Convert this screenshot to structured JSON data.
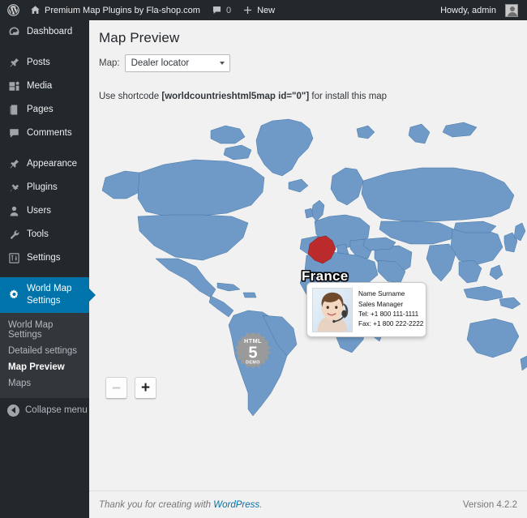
{
  "adminbar": {
    "wp_logo_icon": "wordpress-logo-icon",
    "site_home_icon": "home-icon",
    "site_name": "Premium Map Plugins by Fla-shop.com",
    "comments_icon": "comment-bubble-icon",
    "comments_count": "0",
    "new_icon": "plus-icon",
    "new_label": "New",
    "greeting": "Howdy, admin",
    "avatar_icon": "user-avatar-icon"
  },
  "sidebar": {
    "items": [
      {
        "label": "Dashboard",
        "icon": "dashboard-icon",
        "active": false
      },
      {
        "label": "Posts",
        "icon": "pin-icon",
        "active": false
      },
      {
        "label": "Media",
        "icon": "media-icon",
        "active": false
      },
      {
        "label": "Pages",
        "icon": "page-icon",
        "active": false
      },
      {
        "label": "Comments",
        "icon": "comment-bubble-icon",
        "active": false
      },
      {
        "label": "Appearance",
        "icon": "paintbrush-icon",
        "active": false
      },
      {
        "label": "Plugins",
        "icon": "plug-icon",
        "active": false
      },
      {
        "label": "Users",
        "icon": "user-icon",
        "active": false
      },
      {
        "label": "Tools",
        "icon": "wrench-icon",
        "active": false
      },
      {
        "label": "Settings",
        "icon": "sliders-icon",
        "active": false
      },
      {
        "label": "World Map Settings",
        "icon": "gear-icon",
        "active": true
      }
    ],
    "submenu": [
      {
        "label": "World Map Settings",
        "current": false
      },
      {
        "label": "Detailed settings",
        "current": false
      },
      {
        "label": "Map Preview",
        "current": true
      },
      {
        "label": "Maps",
        "current": false
      }
    ],
    "collapse": {
      "label": "Collapse menu",
      "icon": "collapse-arrow-icon"
    },
    "active_color": "#0073aa",
    "background_color": "#23282d",
    "submenu_background_color": "#32373c"
  },
  "main": {
    "page_title": "Map Preview",
    "map_select": {
      "label": "Map:",
      "value": "Dealer locator",
      "options": [
        "Dealer locator"
      ],
      "caret_icon": "chevron-down-icon"
    },
    "shortcode": {
      "prefix": "Use shortcode ",
      "code": "[worldcountrieshtml5map id=\"0\"]",
      "suffix": " for install this map"
    }
  },
  "map": {
    "selected_country": "France",
    "land_color": "#6f9ac7",
    "land_border_color": "#3c6ea0",
    "highlight_color": "#bb2b2b",
    "background_color": "#f1f1f1",
    "tooltip": {
      "photo_icon": "headset-agent-photo",
      "name": "Name Surname",
      "title": "Sales Manager",
      "tel": "Tel: +1 800 111-1111",
      "fax": "Fax: +1 800 222-2222"
    },
    "badge": {
      "top_text": "HTML",
      "number": "5",
      "bottom_text": "DEMO",
      "color": "#999999"
    },
    "zoom_controls": {
      "zoom_out_label": "–",
      "zoom_out_icon": "minus-icon",
      "zoom_out_disabled": true,
      "zoom_in_label": "+",
      "zoom_in_icon": "plus-icon",
      "zoom_in_disabled": false
    }
  },
  "footer": {
    "thanks_prefix": "Thank you for creating with ",
    "wordpress_link": "WordPress",
    "thanks_suffix": ".",
    "version": "Version 4.2.2"
  }
}
